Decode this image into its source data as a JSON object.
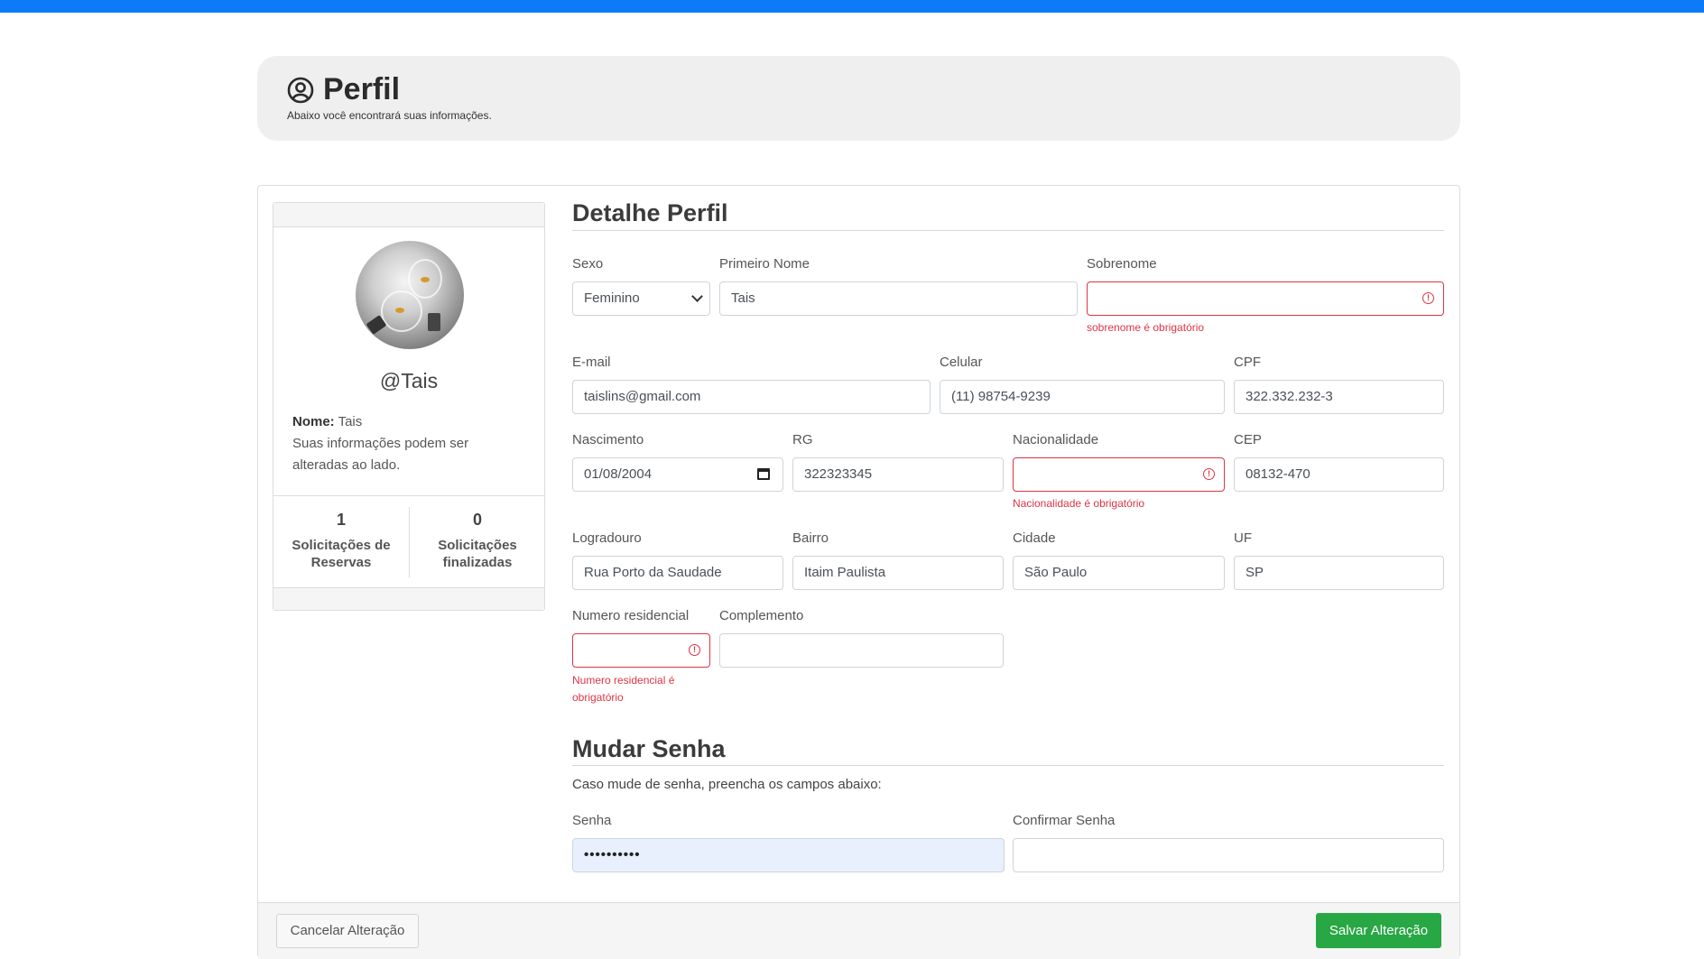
{
  "header": {
    "title": "Perfil",
    "subtitle": "Abaixo você encontrará suas informações."
  },
  "profile_card": {
    "username": "@Tais",
    "name_label": "Nome:",
    "name_value": "Tais",
    "note": "Suas informações podem ser alteradas ao lado.",
    "stats": [
      {
        "num": "1",
        "label": "Solicitações de Reservas"
      },
      {
        "num": "0",
        "label": "Solicitações finalizadas"
      }
    ]
  },
  "details": {
    "section_title": "Detalhe Perfil",
    "sexo": {
      "label": "Sexo",
      "value": "Feminino"
    },
    "primeiro_nome": {
      "label": "Primeiro Nome",
      "value": "Tais"
    },
    "sobrenome": {
      "label": "Sobrenome",
      "value": "",
      "error": "sobrenome é obrigatório"
    },
    "email": {
      "label": "E-mail",
      "value": "taislins@gmail.com"
    },
    "celular": {
      "label": "Celular",
      "value": "(11) 98754-9239"
    },
    "cpf": {
      "label": "CPF",
      "value": "322.332.232-3"
    },
    "nascimento": {
      "label": "Nascimento",
      "value": "01/08/2004"
    },
    "rg": {
      "label": "RG",
      "value": "322323345"
    },
    "nacionalidade": {
      "label": "Nacionalidade",
      "value": "",
      "error": "Nacionalidade é obrigatório"
    },
    "cep": {
      "label": "CEP",
      "value": "08132-470"
    },
    "logradouro": {
      "label": "Logradouro",
      "value": "Rua Porto da Saudade"
    },
    "bairro": {
      "label": "Bairro",
      "value": "Itaim Paulista"
    },
    "cidade": {
      "label": "Cidade",
      "value": "São Paulo"
    },
    "uf": {
      "label": "UF",
      "value": "SP"
    },
    "numero": {
      "label": "Numero residencial",
      "value": "",
      "error": "Numero residencial é obrigatório"
    },
    "complemento": {
      "label": "Complemento",
      "value": ""
    }
  },
  "password": {
    "section_title": "Mudar Senha",
    "hint": "Caso mude de senha, preencha os campos abaixo:",
    "senha": {
      "label": "Senha",
      "value": "••••••••••"
    },
    "confirmar": {
      "label": "Confirmar Senha",
      "value": ""
    }
  },
  "actions": {
    "cancel_label": "Cancelar Alteração",
    "save_label": "Salvar Alteração"
  },
  "colors": {
    "top_bar": "#0d7bf7",
    "error": "#dc3545",
    "save_button": "#28a745"
  }
}
